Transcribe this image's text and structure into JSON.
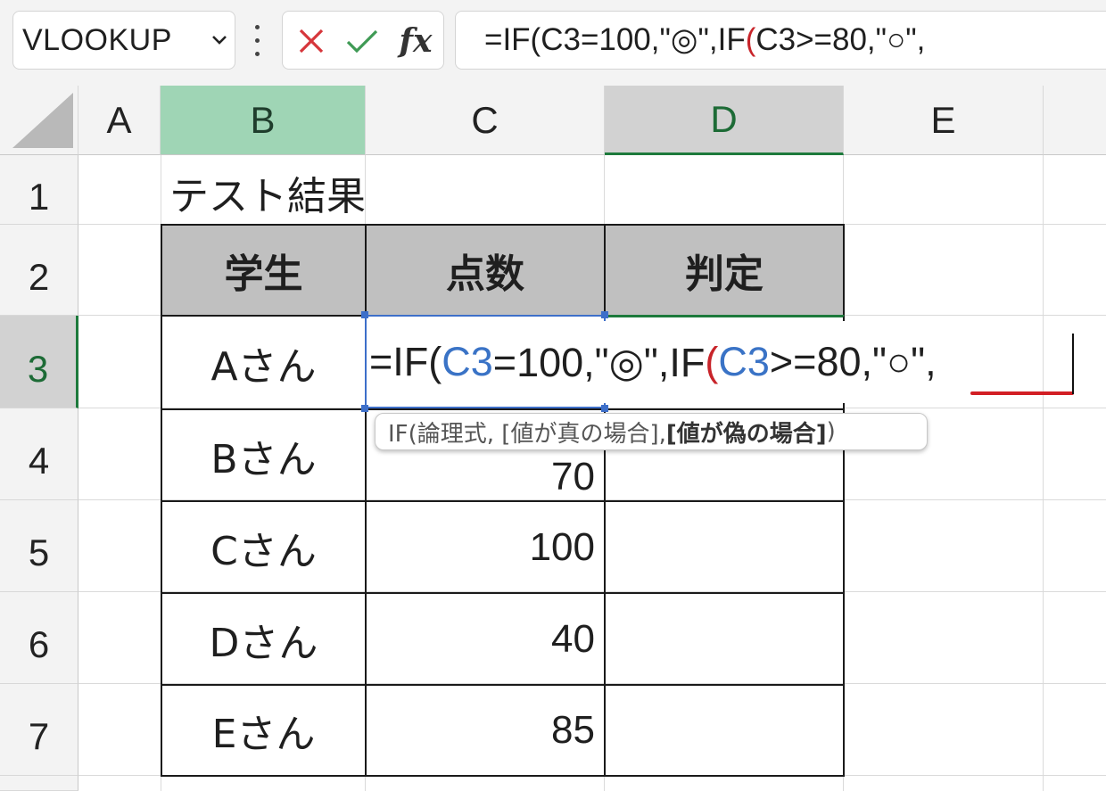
{
  "formula_bar": {
    "name_box": "VLOOKUP",
    "cancel_glyph": "✕",
    "enter_glyph": "✓",
    "fx_label": "fx",
    "formula": {
      "p1": "=IF(C3=100,\"◎\",IF",
      "p2": "(",
      "p3": "C3>=80,\"○\","
    }
  },
  "columns": [
    "A",
    "B",
    "C",
    "D",
    "E"
  ],
  "rows": [
    "1",
    "2",
    "3",
    "4",
    "5",
    "6",
    "7"
  ],
  "sheet": {
    "title": "テスト結果",
    "headers": [
      "学生",
      "点数",
      "判定"
    ],
    "students": [
      "Aさん",
      "Bさん",
      "Cさん",
      "Dさん",
      "Eさん"
    ],
    "scores_visible": {
      "row4": "70",
      "row5": "100",
      "row6": "40",
      "row7": "85"
    }
  },
  "edit": {
    "p1": "=IF(",
    "p2": "C3",
    "p3": "=100,\"◎\",IF",
    "p4": "(",
    "p5": "C3",
    "p6": ">=80,\"○\","
  },
  "tooltip": {
    "fn": "IF(論理式, [値が真の場合], ",
    "bold": "[値が偽の場合]",
    "end": ")"
  },
  "colors": {
    "selected_column_header": "#9fd5b5",
    "active_cell_border": "#3d6fc9",
    "ref_blue": "#3a73c6",
    "paren_red": "#c8242a",
    "squiggle_red": "#d21f24"
  },
  "icons": [
    "chevron-down-icon",
    "more-options-icon",
    "cancel-icon",
    "enter-icon",
    "insert-function-icon",
    "select-all-corner-icon"
  ]
}
